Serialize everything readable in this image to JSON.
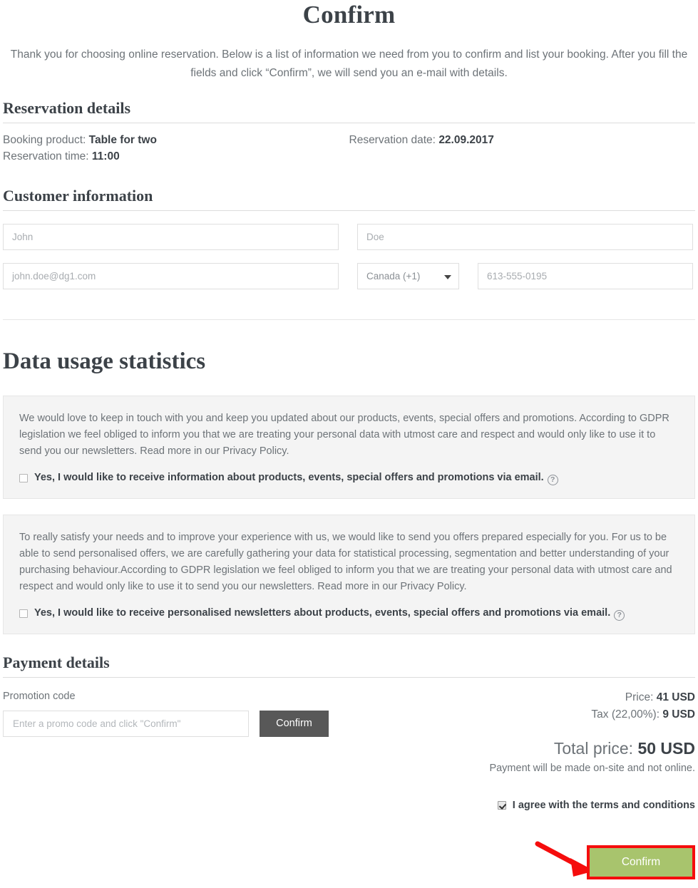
{
  "header": {
    "title": "Confirm",
    "intro": "Thank you for choosing online reservation. Below is a list of information we need from you to confirm and list your booking. After you fill the fields and click “Confirm”, we will send you an e-mail with details."
  },
  "reservation": {
    "heading": "Reservation details",
    "booking_product_label": "Booking product:",
    "booking_product_value": "Table for two",
    "reservation_time_label": "Reservation time:",
    "reservation_time_value": "11:00",
    "reservation_date_label": "Reservation date:",
    "reservation_date_value": "22.09.2017"
  },
  "customer": {
    "heading": "Customer information",
    "first_name": "John",
    "last_name": "Doe",
    "email": "john.doe@dg1.com",
    "country_code": "Canada (+1)",
    "phone": "613-555-0195",
    "caret_icon": "chevron-down-icon"
  },
  "data_usage": {
    "heading": "Data usage statistics",
    "consent_1": {
      "text": "We would love to keep in touch with you and keep you updated about our products, events, special offers and promotions. According to GDPR legislation we feel obliged to inform you that we are treating your personal data with utmost care and respect and would only like to use it to send you our newsletters. Read more in our Privacy Policy.",
      "label": "Yes, I would like to receive information about products, events, special offers and promotions via email.",
      "help_icon": "question-mark-icon",
      "checked": false
    },
    "consent_2": {
      "text": "To really satisfy your needs and to improve your experience with us, we would like to send you offers prepared especially for you. For us to be able to send personalised offers, we are carefully gathering your data for statistical processing, segmentation and better understanding of your purchasing behaviour.According to GDPR legislation we feel obliged to inform you that we are treating your personal data with utmost care and respect and would only like to use it to send you our newsletters. Read more in our Privacy Policy.",
      "label": "Yes, I would like to receive personalised newsletters about products, events, special offers and promotions via email.",
      "help_icon": "question-mark-icon",
      "checked": false
    }
  },
  "payment": {
    "heading": "Payment details",
    "promo_label": "Promotion code",
    "promo_placeholder": "Enter a promo code and click \"Confirm\"",
    "promo_value": "",
    "promo_confirm_label": "Confirm",
    "price_label": "Price:",
    "price_value": "41 USD",
    "tax_label": "Tax (22,00%):",
    "tax_value": "9 USD",
    "total_label": "Total price:",
    "total_value": "50 USD",
    "onsite_note": "Payment will be made on-site and not online.",
    "terms_label": "I agree with the terms and conditions",
    "terms_checked": true,
    "confirm_label": "Confirm"
  },
  "annotation": {
    "arrow_icon": "red-arrow-icon",
    "highlight_color": "#f50d0d",
    "button_color": "#a8c46d"
  }
}
